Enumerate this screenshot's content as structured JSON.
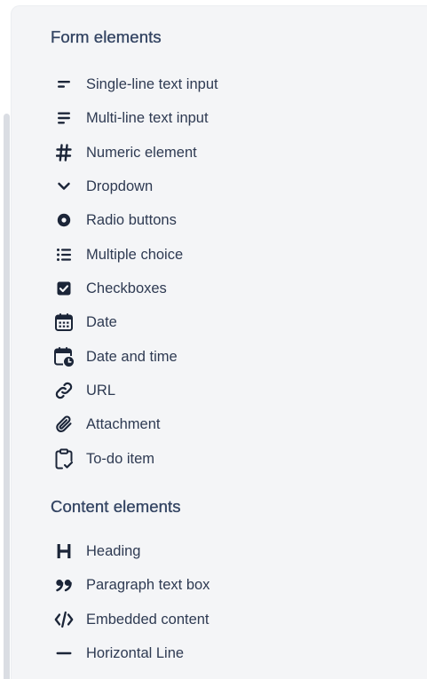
{
  "form_section": {
    "title": "Form elements",
    "items": [
      {
        "label": "Single-line text input",
        "icon": "short-text-icon"
      },
      {
        "label": "Multi-line text input",
        "icon": "long-text-icon"
      },
      {
        "label": "Numeric element",
        "icon": "hash-icon"
      },
      {
        "label": "Dropdown",
        "icon": "chevron-down-icon"
      },
      {
        "label": "Radio buttons",
        "icon": "radio-icon"
      },
      {
        "label": "Multiple choice",
        "icon": "list-icon"
      },
      {
        "label": "Checkboxes",
        "icon": "checkbox-icon"
      },
      {
        "label": "Date",
        "icon": "calendar-icon"
      },
      {
        "label": "Date and time",
        "icon": "calendar-clock-icon"
      },
      {
        "label": "URL",
        "icon": "link-icon"
      },
      {
        "label": "Attachment",
        "icon": "paperclip-icon"
      },
      {
        "label": "To-do item",
        "icon": "clipboard-check-icon"
      }
    ]
  },
  "content_section": {
    "title": "Content elements",
    "items": [
      {
        "label": "Heading",
        "icon": "heading-icon"
      },
      {
        "label": "Paragraph text box",
        "icon": "quote-icon"
      },
      {
        "label": "Embedded content",
        "icon": "code-icon"
      },
      {
        "label": "Horizontal Line",
        "icon": "horizontal-line-icon"
      }
    ]
  },
  "colors": {
    "panel_background": "#f4f5f7",
    "icon": "#1b2538",
    "label": "#2e3a52",
    "section_title": "#344563",
    "scrollbar": "#dadde3"
  }
}
